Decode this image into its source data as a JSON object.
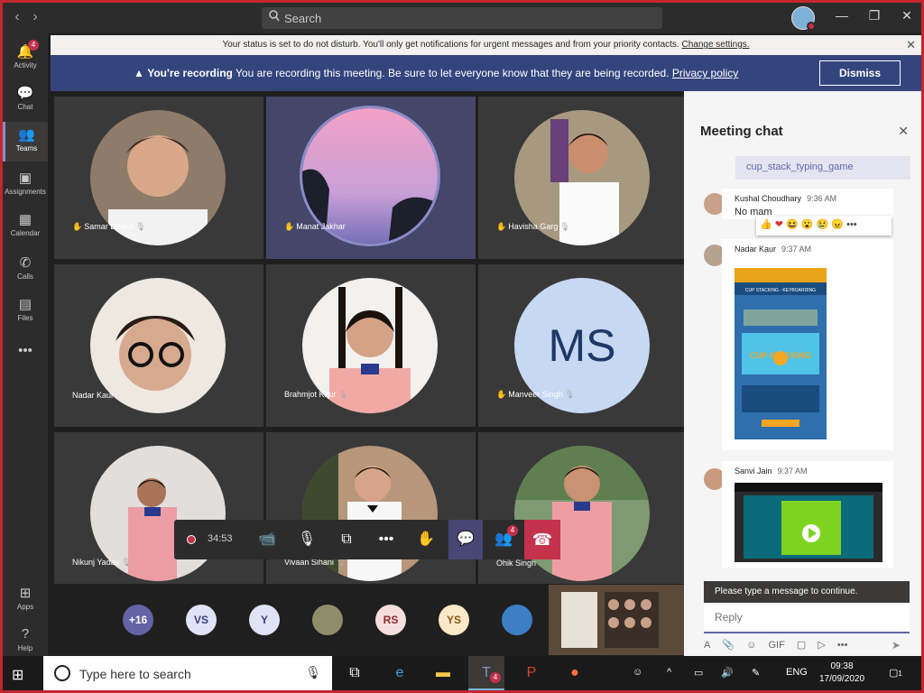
{
  "titlebar": {
    "search_placeholder": "Search",
    "back_glyph": "‹",
    "forward_glyph": "›",
    "minimize_glyph": "—",
    "maximize_glyph": "❐",
    "close_glyph": "✕"
  },
  "rail": {
    "items": [
      {
        "label": "Activity",
        "icon": "bell-icon",
        "badge": "4"
      },
      {
        "label": "Chat",
        "icon": "chat-icon"
      },
      {
        "label": "Teams",
        "icon": "teams-icon"
      },
      {
        "label": "Assignments",
        "icon": "assignments-icon"
      },
      {
        "label": "Calendar",
        "icon": "calendar-icon"
      },
      {
        "label": "Calls",
        "icon": "phone-icon"
      },
      {
        "label": "Files",
        "icon": "files-icon"
      },
      {
        "label": "Apps",
        "icon": "apps-icon"
      },
      {
        "label": "Help",
        "icon": "help-icon"
      }
    ],
    "more_glyph": "•••",
    "active_color": "#8b8cc7"
  },
  "dnd_bar": {
    "text": "Your status is set to do not disturb. You'll only get notifications for urgent messages and from your priority contacts.",
    "link": "Change settings.",
    "close_glyph": "✕"
  },
  "recording_bar": {
    "icon": "warning-icon",
    "title": "You're recording",
    "text": "You are recording this meeting. Be sure to let everyone know that they are being recorded.",
    "link": "Privacy policy",
    "dismiss_label": "Dismiss",
    "color": "#34457e"
  },
  "participants": [
    {
      "name": "Samar Dhaka",
      "hand": true
    },
    {
      "name": "Manat Jakhar",
      "hand": true,
      "speaking": true
    },
    {
      "name": "Havisha Garg",
      "hand": true
    },
    {
      "name": "Nadar Kaur",
      "hand": false
    },
    {
      "name": "Brahmjot Kaur",
      "hand": false
    },
    {
      "name": "Manveer Singh",
      "hand": true,
      "initials": "MS"
    },
    {
      "name": "Nikunj Yadav",
      "hand": false
    },
    {
      "name": "Vivaan Sihani",
      "hand": false
    },
    {
      "name": "Ohik Singh",
      "hand": false
    }
  ],
  "controls": {
    "timer": "34:53",
    "participants_badge": "4",
    "accent": "#c4314b"
  },
  "avatar_strip": [
    {
      "label": "+16",
      "bg": "#6264a7",
      "fg": "#ffffff"
    },
    {
      "label": "VS",
      "bg": "#e0e3f6",
      "fg": "#3b3d7a"
    },
    {
      "label": "Y",
      "bg": "#e0e3f6",
      "fg": "#3b3d7a"
    },
    {
      "label": "",
      "bg": "#8d8d6a",
      "fg": "#ffffff"
    },
    {
      "label": "RS",
      "bg": "#f7dede",
      "fg": "#8a2a2a"
    },
    {
      "label": "YS",
      "bg": "#fbe8c9",
      "fg": "#8a5a10"
    },
    {
      "label": "",
      "bg": "#3d7fc4",
      "fg": "#ffffff"
    }
  ],
  "chat": {
    "title": "Meeting chat",
    "close_glyph": "✕",
    "link_text": "cup_stack_typing_game",
    "messages": [
      {
        "author": "Kushal Choudhary",
        "time": "9:36 AM",
        "text": "No mam"
      },
      {
        "author": "Nadar Kaur",
        "time": "9:37 AM",
        "text": ""
      },
      {
        "author": "Sanvi Jain",
        "time": "9:37 AM",
        "text": ""
      }
    ],
    "reactions": [
      "👍",
      "❤",
      "😆",
      "😮",
      "😢",
      "😠"
    ],
    "reactions_more": "•••",
    "shot1_title": "CUP STACKING - KEYBOARDING",
    "shot1_label": "CUP STACKING",
    "warning": "Please type a message to continue.",
    "reply_placeholder": "Reply",
    "compose_icons": [
      "A",
      "📎",
      "☺",
      "GIF",
      "▢",
      "▷",
      "•••"
    ],
    "send_glyph": "➤"
  },
  "taskbar": {
    "search_placeholder": "Type here to search",
    "teams_badge": "4",
    "language": "ENG",
    "time": "09:38",
    "date": "17/09/2020",
    "notifications": "1"
  }
}
